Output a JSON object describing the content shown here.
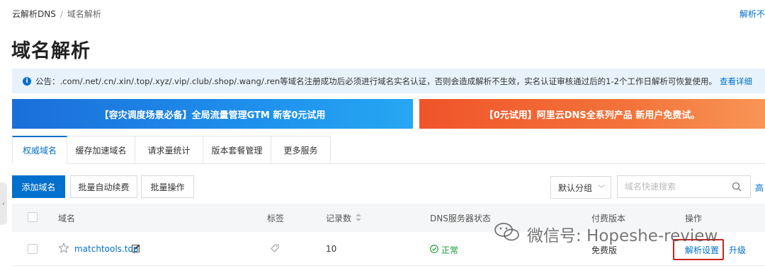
{
  "breadcrumb": {
    "root": "云解析DNS",
    "sep": "/",
    "current": "域名解析"
  },
  "top_right_link": "解析不",
  "page_title": "域名解析",
  "notice": {
    "text": "公告：.com/.net/.cn/.xin/.top/.xyz/.vip/.club/.shop/.wang/.ren等域名注册成功后必须进行域名实名认证，否则会造成解析不生效，实名认证审核通过后的1-2个工作日解析可恢复使用。",
    "link": "查看详细"
  },
  "banners": [
    {
      "text": "【容灾调度场景必备】全局流量管理GTM 新客0元试用",
      "color": "#1e88e5"
    },
    {
      "text": "【0元试用】阿里云DNS全系列产品 新用户免费试。",
      "color": "#f2602f"
    }
  ],
  "tabs": [
    "权威域名",
    "缓存加速域名",
    "请求量统计",
    "版本套餐管理",
    "更多服务"
  ],
  "toolbar": {
    "add": "添加域名",
    "batch_renew": "批量自动续费",
    "batch_ops": "批量操作",
    "group_select": "默认分组",
    "search_placeholder": "域名快速搜索",
    "advanced": "高"
  },
  "table": {
    "headers": {
      "domain": "域名",
      "tags": "标签",
      "records": "记录数",
      "dns_status": "DNS服务器状态",
      "plan": "付费版本",
      "actions": "操作"
    },
    "rows": [
      {
        "domain": "matchtools.top",
        "records": "10",
        "dns_status": "正常",
        "plan": "免费版",
        "action_settings": "解析设置",
        "action_upgrade": "升级"
      }
    ]
  },
  "watermark": "微信号: Hopeshe-review",
  "colors": {
    "accent": "#0070cc",
    "ok": "#1a9a3a",
    "highlight": "#d0221c"
  }
}
